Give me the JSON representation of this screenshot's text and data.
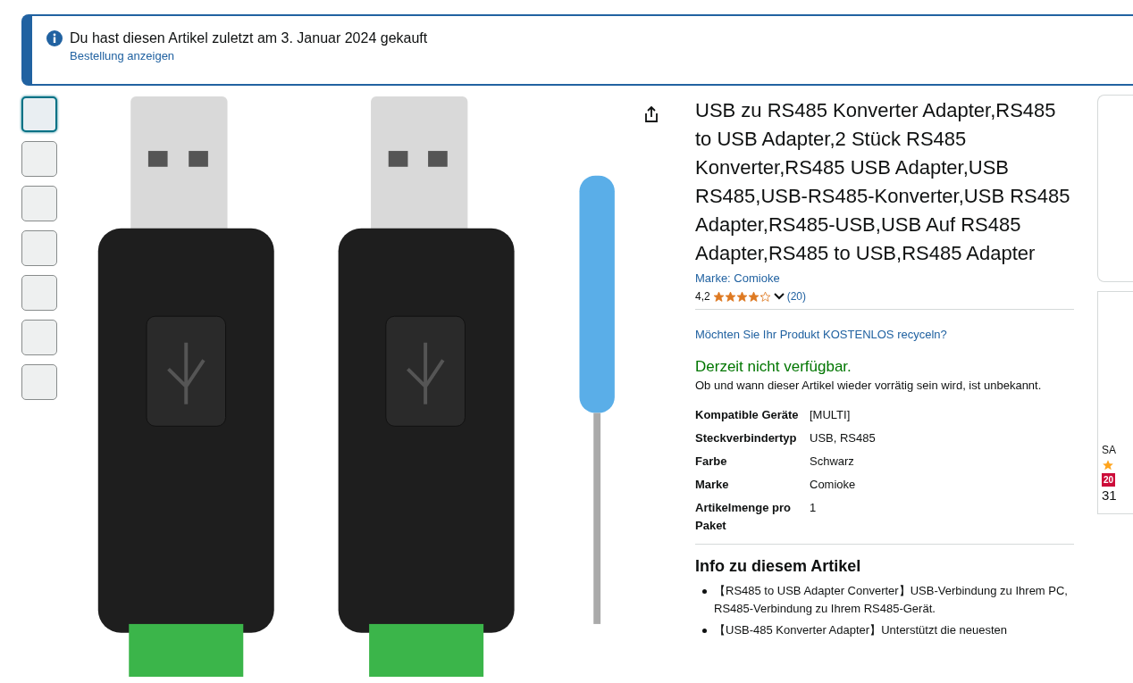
{
  "notice": {
    "message": "Du hast diesen Artikel zuletzt am 3. Januar 2024 gekauft",
    "link": "Bestellung anzeigen"
  },
  "thumbnails": [
    {
      "selected": true
    },
    {
      "selected": false
    },
    {
      "selected": false
    },
    {
      "selected": false
    },
    {
      "selected": false
    },
    {
      "selected": false
    },
    {
      "selected": false
    }
  ],
  "product": {
    "title": "USB zu RS485 Konverter Adapter,RS485 to USB Adapter,2 Stück RS485 Konverter,RS485 USB Adapter,USB RS485,USB-RS485-Konverter,USB RS485 Adapter,RS485-USB,USB Auf RS485 Adapter,RS485 to USB,RS485 Adapter",
    "brand_link": "Marke: Comioke",
    "rating": "4,2",
    "stars": 4.2,
    "review_count": "(20)",
    "recycle_link": "Möchten Sie Ihr Produkt KOSTENLOS recyceln?",
    "availability": "Derzeit nicht verfügbar.",
    "availability_note": "Ob und wann dieser Artikel wieder vorrätig sein wird, ist unbekannt.",
    "specs": [
      {
        "label": "Kompatible Geräte",
        "value": "[MULTI]"
      },
      {
        "label": "Steckverbindertyp",
        "value": "USB, RS485"
      },
      {
        "label": "Farbe",
        "value": "Schwarz"
      },
      {
        "label": "Marke",
        "value": "Comioke"
      },
      {
        "label": "Artikelmenge pro Paket",
        "value": "1"
      }
    ],
    "info_heading": "Info zu diesem Artikel",
    "bullets": [
      "【RS485 to USB Adapter Converter】USB-Verbindung zu Ihrem PC, RS485-Verbindung zu Ihrem RS485-Gerät.",
      "【USB-485 Konverter Adapter】Unterstützt die neuesten"
    ]
  },
  "side_card": {
    "title": "SA",
    "badge": "20",
    "price": "31"
  }
}
